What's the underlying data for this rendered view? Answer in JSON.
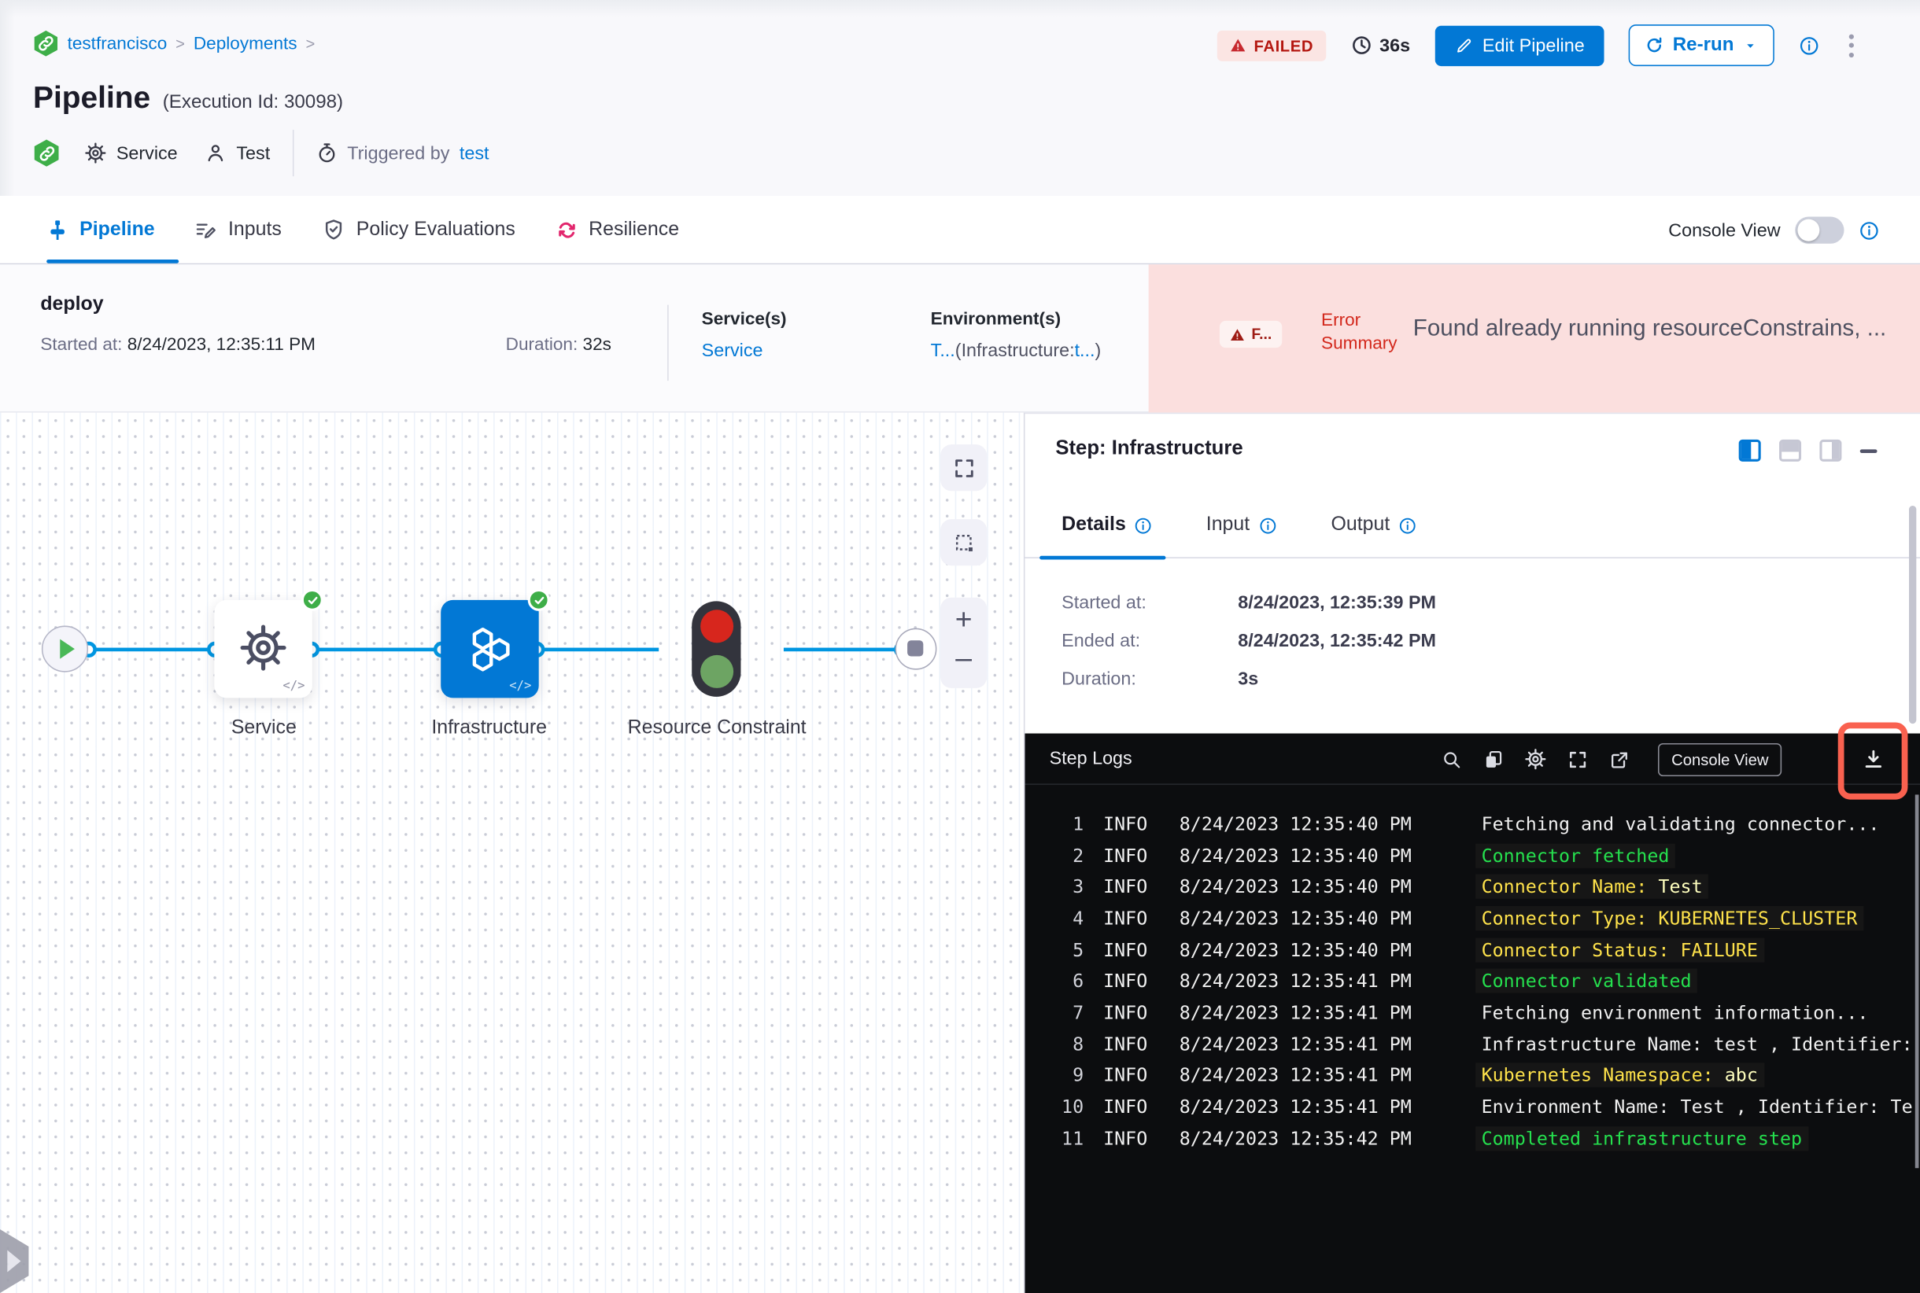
{
  "header": {
    "breadcrumb": [
      {
        "label": "testfrancisco"
      },
      {
        "label": "Deployments"
      }
    ],
    "status_badge": "FAILED",
    "elapsed": "36s",
    "edit_pipeline": "Edit Pipeline",
    "rerun": "Re-run",
    "title": "Pipeline",
    "execution_id": "(Execution Id: 30098)",
    "meta": {
      "service_label": "Service",
      "test_label": "Test",
      "triggered_prefix": "Triggered by",
      "triggered_by": "test"
    }
  },
  "tabs": {
    "pipeline": "Pipeline",
    "inputs": "Inputs",
    "policy": "Policy Evaluations",
    "resilience": "Resilience",
    "console_view_label": "Console View"
  },
  "summary": {
    "stage_name": "deploy",
    "started_label": "Started at:",
    "started_value": "8/24/2023, 12:35:11 PM",
    "duration_label": "Duration:",
    "duration_value": "32s",
    "services_label": "Service(s)",
    "service_link": "Service",
    "environments_label": "Environment(s)",
    "environment_parts": [
      {
        "text": "T...",
        "style": "link"
      },
      {
        "text": "(Infrastructure:",
        "style": "plain"
      },
      {
        "text": "t...",
        "style": "link"
      },
      {
        "text": ")",
        "style": "plain"
      }
    ],
    "error_badge": "F...",
    "error_label_line1": "Error",
    "error_label_line2": "Summary",
    "error_message": "Found already running resourceConstrains, ..."
  },
  "graph": {
    "nodes": [
      {
        "label": "Service"
      },
      {
        "label": "Infrastructure"
      },
      {
        "label": "Resource Constraint"
      }
    ]
  },
  "step_panel": {
    "title": "Step: Infrastructure",
    "tab_details": "Details",
    "tab_input": "Input",
    "tab_output": "Output",
    "rows": [
      {
        "label": "Started at:",
        "value": "8/24/2023, 12:35:39 PM"
      },
      {
        "label": "Ended at:",
        "value": "8/24/2023, 12:35:42 PM"
      },
      {
        "label": "Duration:",
        "value": "3s"
      }
    ]
  },
  "logs": {
    "title": "Step Logs",
    "console_view_button": "Console View",
    "lines": [
      {
        "n": "1",
        "level": "INFO",
        "time": "8/24/2023 12:35:40 PM",
        "parts": [
          {
            "text": "Fetching and validating connector...",
            "color": "white"
          }
        ]
      },
      {
        "n": "2",
        "level": "INFO",
        "time": "8/24/2023 12:35:40 PM",
        "parts": [
          {
            "text": "Connector fetched",
            "color": "green"
          }
        ]
      },
      {
        "n": "3",
        "level": "INFO",
        "time": "8/24/2023 12:35:40 PM",
        "parts": [
          {
            "text": "Connector Name: ",
            "color": "yellow"
          },
          {
            "text": "Test",
            "color": "pale"
          }
        ]
      },
      {
        "n": "4",
        "level": "INFO",
        "time": "8/24/2023 12:35:40 PM",
        "parts": [
          {
            "text": "Connector Type: KUBERNETES_CLUSTER",
            "color": "yellow"
          }
        ]
      },
      {
        "n": "5",
        "level": "INFO",
        "time": "8/24/2023 12:35:40 PM",
        "parts": [
          {
            "text": "Connector Status: FAILURE",
            "color": "yellow"
          }
        ]
      },
      {
        "n": "6",
        "level": "INFO",
        "time": "8/24/2023 12:35:41 PM",
        "parts": [
          {
            "text": "Connector validated",
            "color": "green"
          }
        ]
      },
      {
        "n": "7",
        "level": "INFO",
        "time": "8/24/2023 12:35:41 PM",
        "parts": [
          {
            "text": "Fetching environment information...",
            "color": "white"
          }
        ]
      },
      {
        "n": "8",
        "level": "INFO",
        "time": "8/24/2023 12:35:41 PM",
        "parts": [
          {
            "text": "Infrastructure Name: test , Identifier:",
            "color": "white"
          }
        ]
      },
      {
        "n": "9",
        "level": "INFO",
        "time": "8/24/2023 12:35:41 PM",
        "parts": [
          {
            "text": "Kubernetes Namespace: ",
            "color": "yellow"
          },
          {
            "text": "abc",
            "color": "pale"
          }
        ]
      },
      {
        "n": "10",
        "level": "INFO",
        "time": "8/24/2023 12:35:41 PM",
        "parts": [
          {
            "text": "Environment Name: Test , Identifier: Te",
            "color": "white"
          }
        ]
      },
      {
        "n": "11",
        "level": "INFO",
        "time": "8/24/2023 12:35:42 PM",
        "parts": [
          {
            "text": "Completed infrastructure step",
            "color": "green"
          }
        ]
      }
    ]
  },
  "colors": {
    "accent": "#0278d5",
    "failed_red": "#b41710",
    "pink_bg": "#fbdfde",
    "edge_blue": "#0096e1",
    "log_green": "#25e04e",
    "log_yellow": "#fee24b",
    "node_blue": "#0278d5",
    "check_green": "#3eae48"
  }
}
